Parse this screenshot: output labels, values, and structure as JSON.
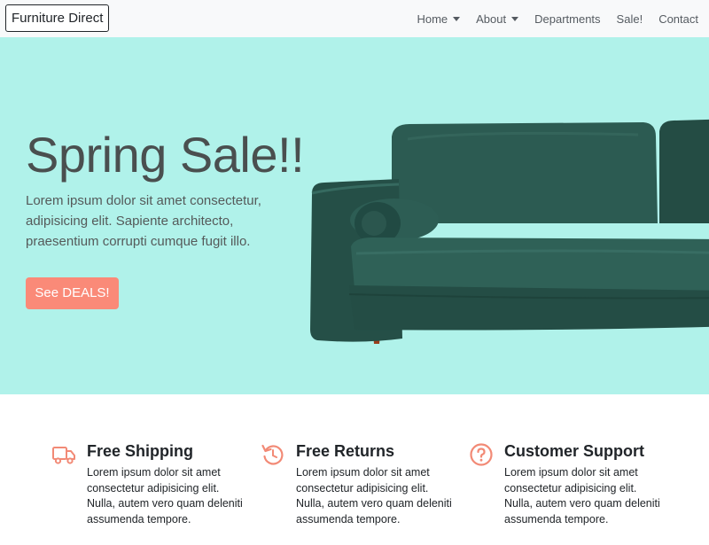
{
  "nav": {
    "brand": "Furniture Direct",
    "items": [
      {
        "label": "Home",
        "dropdown": true
      },
      {
        "label": "About",
        "dropdown": true
      },
      {
        "label": "Departments",
        "dropdown": false
      },
      {
        "label": "Sale!",
        "dropdown": false
      },
      {
        "label": "Contact",
        "dropdown": false
      }
    ]
  },
  "hero": {
    "title": "Spring Sale!!",
    "text": "Lorem ipsum dolor sit amet consectetur, adipisicing elit. Sapiente architecto, praesentium corrupti cumque fugit illo.",
    "cta_label": "See DEALS!",
    "image": "velvet-sofa-image"
  },
  "features": [
    {
      "icon": "truck-icon",
      "title": "Free Shipping",
      "text": "Lorem ipsum dolor sit amet consectetur adipisicing elit. Nulla, autem vero quam deleniti assumenda tempore."
    },
    {
      "icon": "undo-arrow-icon",
      "title": "Free Returns",
      "text": "Lorem ipsum dolor sit amet consectetur adipisicing elit. Nulla, autem vero quam deleniti assumenda tempore."
    },
    {
      "icon": "question-circle-icon",
      "title": "Customer Support",
      "text": "Lorem ipsum dolor sit amet consectetur adipisicing elit. Nulla, autem vero quam deleniti assumenda tempore."
    }
  ],
  "colors": {
    "hero_bg": "#b0f2ea",
    "accent": "#fa8a78",
    "sofa": "#2a564e",
    "navbar_bg": "#f8f9fa"
  }
}
